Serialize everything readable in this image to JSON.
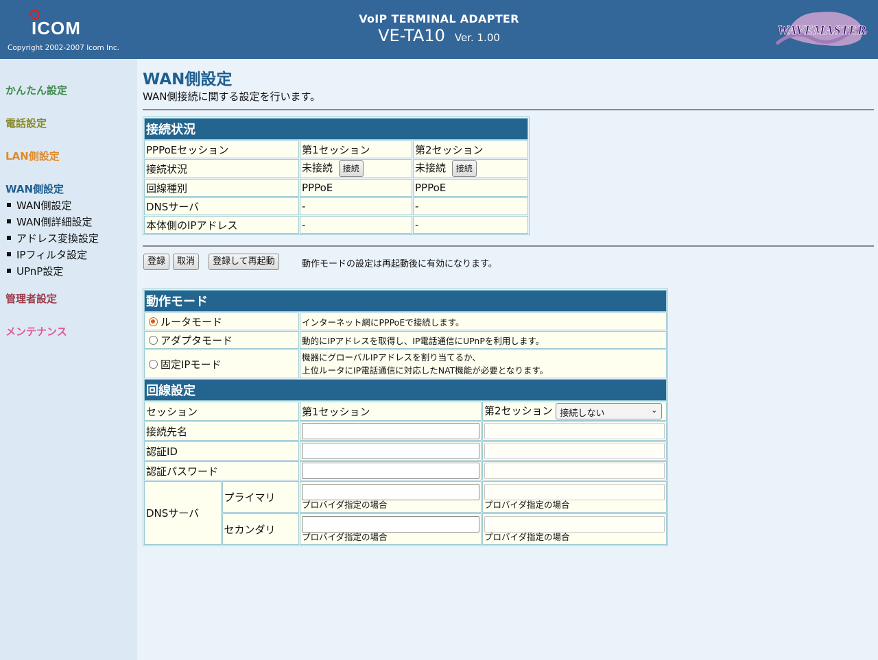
{
  "header": {
    "logo_text": "ICOM",
    "copyright": "Copyright 2002-2007 Icom Inc.",
    "product": "VoIP TERMINAL ADAPTER",
    "model": "VE-TA10",
    "version": "Ver. 1.00",
    "brand_logo_text": "WAVEMASTER"
  },
  "sidebar": {
    "categories": [
      {
        "label": "かんたん設定",
        "color": "#3f8a4a"
      },
      {
        "label": "電話設定",
        "color": "#8a8a2a"
      },
      {
        "label": "LAN側設定",
        "color": "#e08a28"
      },
      {
        "label": "WAN側設定",
        "color": "#1f5f8f"
      },
      {
        "label": "管理者設定",
        "color": "#9b3a4a"
      },
      {
        "label": "メンテナンス",
        "color": "#e05a9a"
      }
    ],
    "wan_items": [
      "WAN側設定",
      "WAN側詳細設定",
      "アドレス変換設定",
      "IPフィルタ設定",
      "UPnP設定"
    ]
  },
  "page": {
    "title": "WAN側設定",
    "description": "WAN側接続に関する設定を行います。"
  },
  "status": {
    "heading": "接続状況",
    "rows": [
      {
        "label": "PPPoEセッション",
        "s1": "第1セッション",
        "s2": "第2セッション"
      },
      {
        "label": "接続状況",
        "s1": "未接続",
        "s2": "未接続"
      },
      {
        "label": "回線種別",
        "s1": "PPPoE",
        "s2": "PPPoE"
      },
      {
        "label": "DNSサーバ",
        "s1": "-",
        "s2": "-"
      },
      {
        "label": "本体側のIPアドレス",
        "s1": "-",
        "s2": "-"
      }
    ],
    "connect_button": "接続"
  },
  "actions": {
    "register": "登録",
    "cancel": "取消",
    "register_restart": "登録して再起動",
    "note": "動作モードの設定は再起動後に有効になります。"
  },
  "mode": {
    "heading": "動作モード",
    "options": [
      {
        "label": "ルータモード",
        "desc": "インターネット網にPPPoEで接続します。",
        "selected": true
      },
      {
        "label": "アダプタモード",
        "desc": "動的にIPアドレスを取得し、IP電話通信にUPnPを利用します。",
        "selected": false
      },
      {
        "label": "固定IPモード",
        "desc_line1": "機器にグローバルIPアドレスを割り当てるか、",
        "desc_line2": "上位ルータにIP電話通信に対応したNAT機能が必要となります。",
        "selected": false
      }
    ]
  },
  "line": {
    "heading": "回線設定",
    "session_label": "セッション",
    "session1": "第1セッション",
    "session2": "第2セッション",
    "session2_select": "接続しない",
    "connection_name": "接続先名",
    "auth_id": "認証ID",
    "auth_password": "認証パスワード",
    "dns_label": "DNSサーバ",
    "primary": "プライマリ",
    "secondary": "セカンダリ",
    "provider_hint": "プロバイダ指定の場合"
  }
}
